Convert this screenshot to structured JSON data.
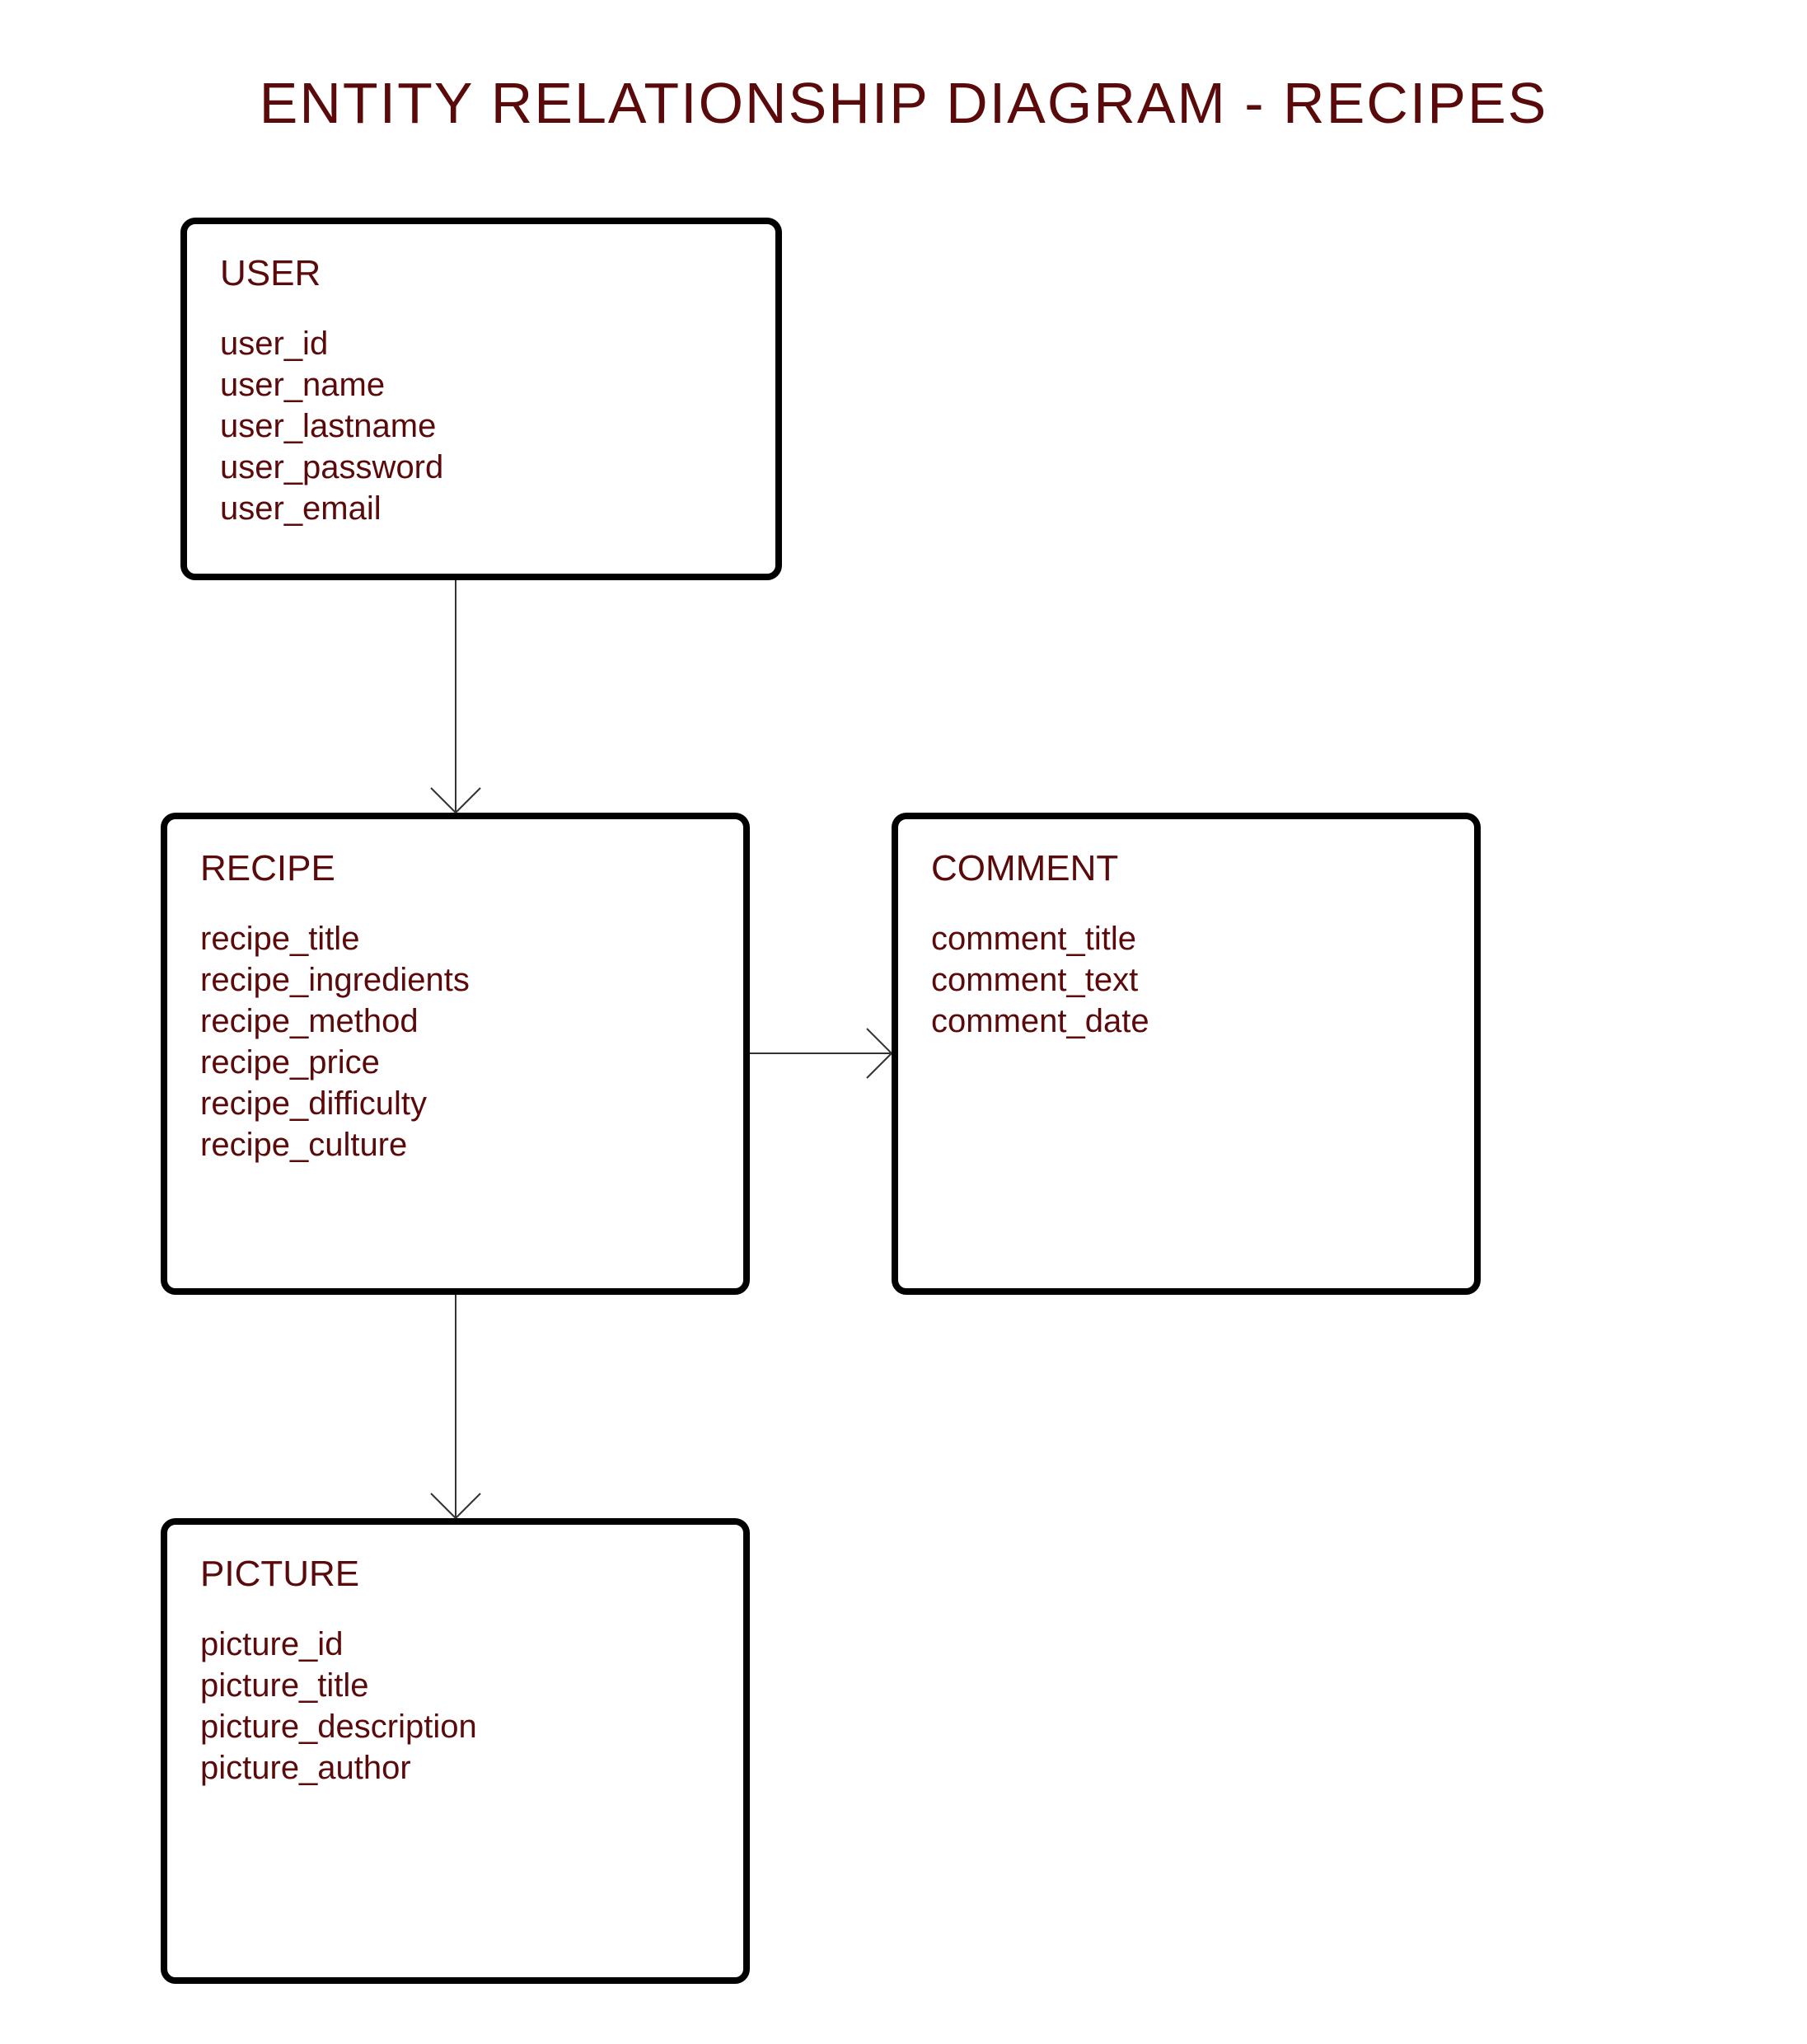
{
  "title": "ENTITY RELATIONSHIP DIAGRAM - RECIPES",
  "entities": {
    "user": {
      "name": "USER",
      "attrs": [
        "user_id",
        "user_name",
        "user_lastname",
        "user_password",
        "user_email"
      ]
    },
    "recipe": {
      "name": "RECIPE",
      "attrs": [
        "recipe_title",
        "recipe_ingredients",
        "recipe_method",
        "recipe_price",
        "recipe_difficulty",
        "recipe_culture"
      ]
    },
    "comment": {
      "name": "COMMENT",
      "attrs": [
        "comment_title",
        "comment_text",
        "comment_date"
      ]
    },
    "picture": {
      "name": "PICTURE",
      "attrs": [
        "picture_id",
        "picture_title",
        "picture_description",
        "picture_author"
      ]
    }
  }
}
